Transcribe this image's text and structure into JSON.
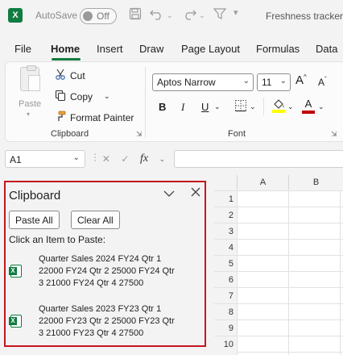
{
  "titlebar": {
    "app_icon": "excel-logo",
    "autosave_label": "AutoSave",
    "autosave_state": "Off",
    "doc_title": "Freshness tracker"
  },
  "tabs": [
    {
      "label": "File"
    },
    {
      "label": "Home",
      "active": true
    },
    {
      "label": "Insert"
    },
    {
      "label": "Draw"
    },
    {
      "label": "Page Layout"
    },
    {
      "label": "Formulas"
    },
    {
      "label": "Data"
    }
  ],
  "ribbon": {
    "clipboard": {
      "paste_label": "Paste",
      "cut_label": "Cut",
      "copy_label": "Copy",
      "format_painter_label": "Format Painter",
      "group_label": "Clipboard"
    },
    "font": {
      "font_name": "Aptos Narrow",
      "font_size": "11",
      "grow_label": "A",
      "shrink_label": "A",
      "bold_label": "B",
      "italic_label": "I",
      "underline_label": "U",
      "font_color_label": "A",
      "group_label": "Font",
      "highlight_color": "#ffff00",
      "font_color": "#c00000"
    }
  },
  "formula_bar": {
    "name_box": "A1",
    "fx_label": "fx",
    "value": ""
  },
  "clipboard_pane": {
    "title": "Clipboard",
    "paste_all_label": "Paste All",
    "clear_all_label": "Clear All",
    "hint": "Click an Item to Paste:",
    "border_color": "#c5161d",
    "items": [
      {
        "line1": "Quarter Sales 2024 FY24 Qtr 1",
        "line2": "22000 FY24 Qtr 2 25000 FY24 Qtr",
        "line3": "3 21000 FY24 Qtr 4 27500"
      },
      {
        "line1": "Quarter Sales 2023 FY23 Qtr 1",
        "line2": "22000 FY23 Qtr 2 25000 FY23 Qtr",
        "line3": "3 21000 FY23 Qtr 4 27500"
      }
    ]
  },
  "grid": {
    "columns": [
      "A",
      "B"
    ],
    "rows": [
      "1",
      "2",
      "3",
      "4",
      "5",
      "6",
      "7",
      "8",
      "9",
      "10"
    ]
  },
  "colors": {
    "accent": "#107c41"
  }
}
